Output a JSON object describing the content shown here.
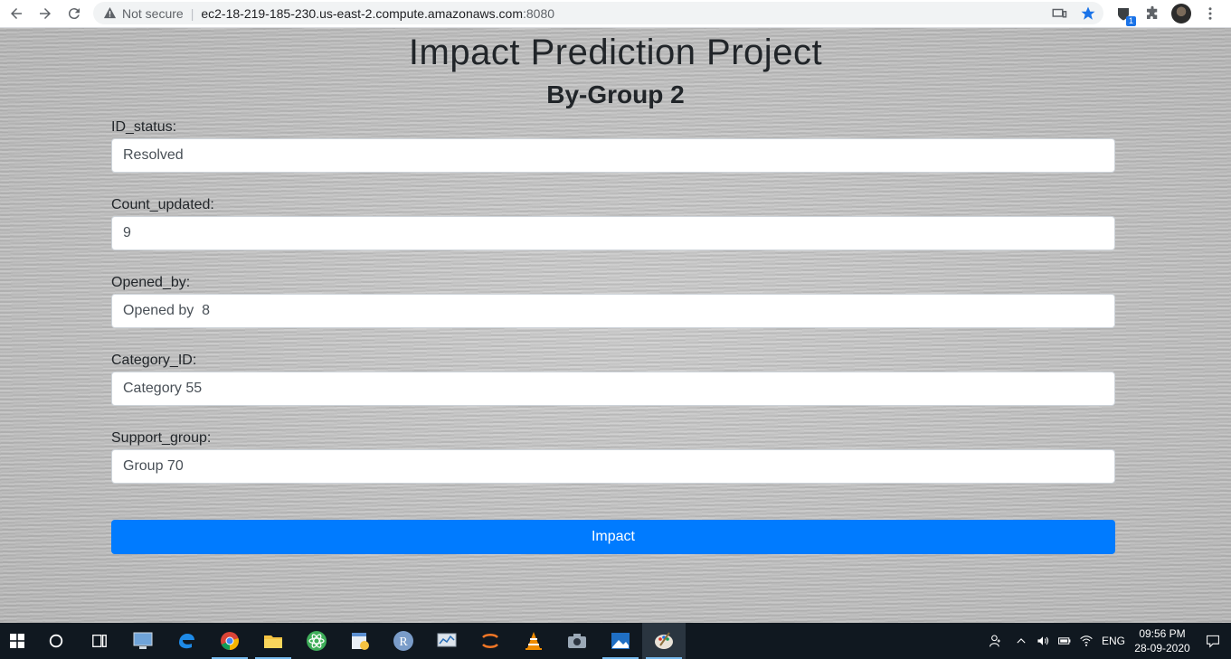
{
  "browser": {
    "security_label": "Not secure",
    "url_host": "ec2-18-219-185-230.us-east-2.compute.amazonaws.com",
    "url_port": ":8080",
    "extension_badge": "1"
  },
  "page": {
    "title": "Impact Prediction Project",
    "subtitle": "By-Group 2",
    "fields": [
      {
        "label": "ID_status:",
        "value": "Resolved"
      },
      {
        "label": "Count_updated:",
        "value": "9"
      },
      {
        "label": "Opened_by:",
        "value": "Opened by  8"
      },
      {
        "label": "Category_ID:",
        "value": "Category 55"
      },
      {
        "label": "Support_group:",
        "value": "Group 70"
      }
    ],
    "submit_label": "Impact"
  },
  "taskbar": {
    "language": "ENG",
    "time": "09:56 PM",
    "date": "28-09-2020"
  },
  "colors": {
    "primary": "#007bff",
    "taskbar": "#101820"
  }
}
